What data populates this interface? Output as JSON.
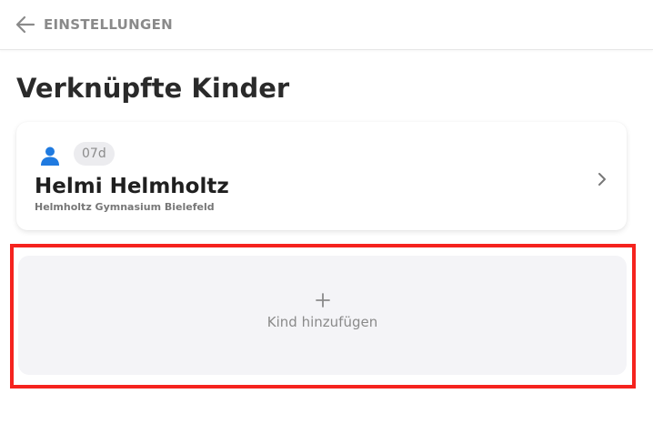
{
  "header": {
    "back_label": "EINSTELLUNGEN"
  },
  "page": {
    "title": "Verknüpfte Kinder"
  },
  "children": [
    {
      "class": "07d",
      "name": "Helmi Helmholtz",
      "school": "Helmholtz Gymnasium Bielefeld"
    }
  ],
  "add_child": {
    "label": "Kind hinzufügen"
  },
  "icons": {
    "back": "arrow-left-icon",
    "person": "person-icon",
    "chevron": "chevron-right-icon",
    "plus": "plus-icon"
  },
  "colors": {
    "accent_blue": "#1f7ae0",
    "highlight_red": "#f5231e",
    "muted_text": "#8a8a8a"
  }
}
